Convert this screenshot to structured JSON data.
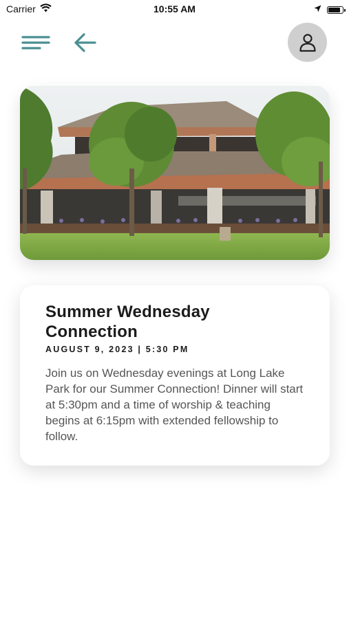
{
  "status_bar": {
    "carrier": "Carrier",
    "time": "10:55 AM",
    "wifi_icon": "wifi-icon",
    "location_icon": "location-arrow-icon",
    "battery_icon": "battery-icon",
    "battery_level": 0.9
  },
  "nav": {
    "menu_icon": "menu-icon",
    "back_icon": "arrow-left-icon",
    "profile_icon": "user-icon"
  },
  "hero": {
    "image_subject": "park-pavilion-photo"
  },
  "event": {
    "title": "Summer Wednesday Connection",
    "date": "AUGUST 9, 2023 | 5:30 PM",
    "description": "Join us on Wednesday evenings at Long Lake Park for our Summer Connection! Dinner will start at 5:30pm and a time of worship & teaching begins at 6:15pm with extended fellowship to follow."
  },
  "colors": {
    "accent": "#4a8f91",
    "profile_bg": "#cfcfcf",
    "text_dark": "#1b1b1b",
    "text_body": "#555555"
  }
}
